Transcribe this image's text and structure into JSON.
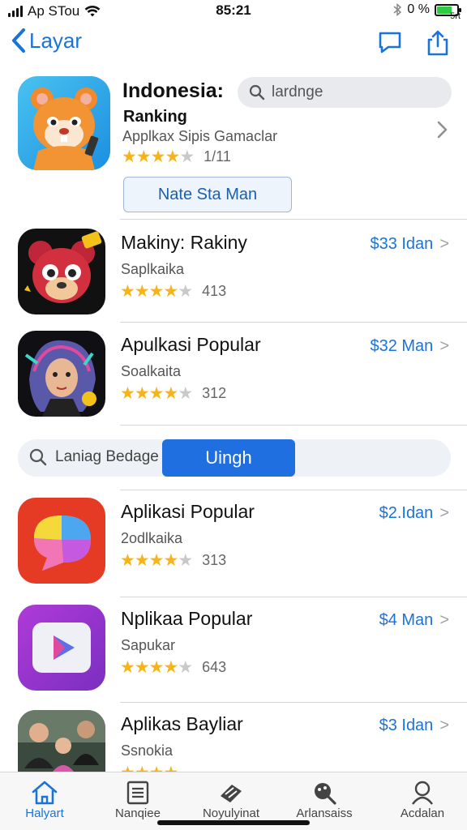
{
  "status_bar": {
    "carrier": "Ap STou",
    "time": "85:21",
    "right_text": "0 %",
    "battery_level": 0.7,
    "battery_label": "5rt"
  },
  "nav": {
    "back_label": "Layar"
  },
  "featured": {
    "title": "Indonesia:",
    "subtitle": "Ranking",
    "description": "Applkax Sipis Gamaclar",
    "search_placeholder": "lardnge",
    "rating": 4.5,
    "rating_count": "1/11",
    "button_label": "Nate Sta Man"
  },
  "apps": [
    {
      "title": "Makiny: Rakiny",
      "subtitle": "Saplkaika",
      "price": "$33 Idan",
      "rating": 4.5,
      "rating_count": "413",
      "icon": "red-bear-icon"
    },
    {
      "title": "Apulkasi Popular",
      "subtitle": "Soalkaita",
      "price": "$32 Man",
      "rating": 4.5,
      "rating_count": "312",
      "icon": "anime-girl-icon"
    }
  ],
  "search_bar": {
    "label": "Laniag Bedage",
    "button_label": "Uingh"
  },
  "apps2": [
    {
      "title": "Aplikasi Popular",
      "subtitle": "2odlkaika",
      "price": "$2.Idan",
      "rating": 4.5,
      "rating_count": "313",
      "icon": "chat-bubble-icon"
    },
    {
      "title": "Nplikaa Popular",
      "subtitle": "Sapukar",
      "price": "$4 Man",
      "rating": 4.5,
      "rating_count": "643",
      "icon": "play-icon"
    },
    {
      "title": "Aplikas Bayliar",
      "subtitle": "Ssnokia",
      "price": "$3 Idan",
      "rating": 4.5,
      "rating_count": "",
      "icon": "people-photo-icon"
    }
  ],
  "tabs": [
    {
      "label": "Halyart",
      "icon": "home-icon",
      "active": true
    },
    {
      "label": "Nanqiee",
      "icon": "list-icon",
      "active": false
    },
    {
      "label": "Noyulyinat",
      "icon": "games-icon",
      "active": false
    },
    {
      "label": "Arlansaiss",
      "icon": "search-icon",
      "active": false
    },
    {
      "label": "Acdalan",
      "icon": "account-icon",
      "active": false
    }
  ],
  "colors": {
    "accent": "#1a73d9",
    "button_blue": "#1f6fe0",
    "star": "#f6b41a"
  }
}
